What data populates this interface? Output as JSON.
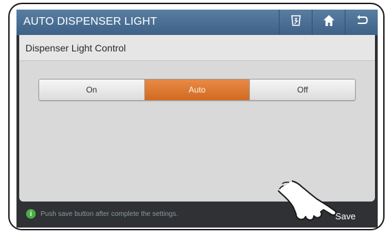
{
  "header": {
    "title": "AUTO DISPENSER LIGHT",
    "buttons": [
      {
        "icon": "dispenser-icon"
      },
      {
        "icon": "home-icon"
      },
      {
        "icon": "back-icon"
      }
    ]
  },
  "panel": {
    "title": "Dispenser Light Control",
    "options": [
      "On",
      "Auto",
      "Off"
    ],
    "selected": "Auto"
  },
  "footer": {
    "hint": "Push save button after complete the settings.",
    "save_label": "Save"
  },
  "colors": {
    "title_bar": "#4a6f94",
    "active_option": "#dd7a32",
    "info_icon": "#4cae46"
  }
}
